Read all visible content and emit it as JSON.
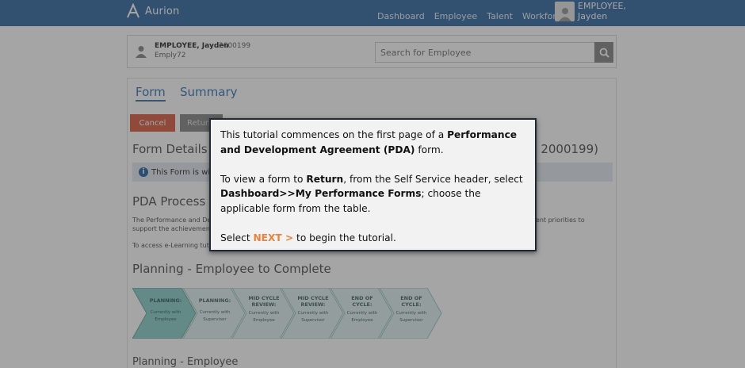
{
  "header": {
    "logo_text": "Aurion",
    "nav": [
      "Dashboard",
      "Employee",
      "Talent",
      "Workforce"
    ],
    "user_line1": "EMPLOYEE,",
    "user_line2": "Jayden"
  },
  "employee_card": {
    "name": "EMPLOYEE, Jayden",
    "id": "2000199",
    "sub": "Emply72",
    "search_placeholder": "Search for Employee"
  },
  "tabs": {
    "form": "Form",
    "summary": "Summary"
  },
  "buttons": {
    "cancel": "Cancel",
    "return": "Return"
  },
  "form": {
    "title_left": "Form Details -",
    "title_right": "n 2000199)",
    "info_text": "This Form is with",
    "pda_title": "PDA Process",
    "pda_text_1": "The Performance and Dev",
    "pda_text_2": "support the achievement",
    "pda_text_right": "elopment priorities to",
    "elearning_text": "To access e-Learning tuto",
    "planning_title": "Planning - Employee to Complete",
    "bottom_title": "Planning - Employee"
  },
  "stages": [
    {
      "title": "PLANNING:",
      "line2": "Currently with",
      "line3": "Employee"
    },
    {
      "title": "PLANNING:",
      "line2": "Currently with",
      "line3": "Supervisor"
    },
    {
      "title": "MID CYCLE",
      "title2": "REVIEW:",
      "line2": "Currently with",
      "line3": "Employee"
    },
    {
      "title": "MID CYCLE",
      "title2": "REVIEW:",
      "line2": "Currently with",
      "line3": "Supervisor"
    },
    {
      "title": "END OF",
      "title2": "CYCLE:",
      "line2": "Currently with",
      "line3": "Employee"
    },
    {
      "title": "END OF",
      "title2": "CYCLE:",
      "line2": "Currently with",
      "line3": "Supervisor"
    }
  ],
  "dialog": {
    "p1_a": "This tutorial commences on the first page of a ",
    "p1_b": "Performance and Development Agreement (PDA)",
    "p1_c": " form.",
    "p2_a": "To view a form to ",
    "p2_b": "Return",
    "p2_c": ", from the Self Service header, select ",
    "p2_d": "Dashboard>>My Performance Forms",
    "p2_e": "; choose the applicable form from the table.",
    "p3_a": "Select ",
    "p3_b": "NEXT >",
    "p3_c": " to begin the tutorial."
  },
  "colors": {
    "header": "#3a6ea5",
    "accent": "#3a7ab8",
    "cancel": "#d9634a",
    "next": "#e8823c",
    "stage_active": "#8fd0cc",
    "stage_inactive": "#e2f2f1"
  }
}
